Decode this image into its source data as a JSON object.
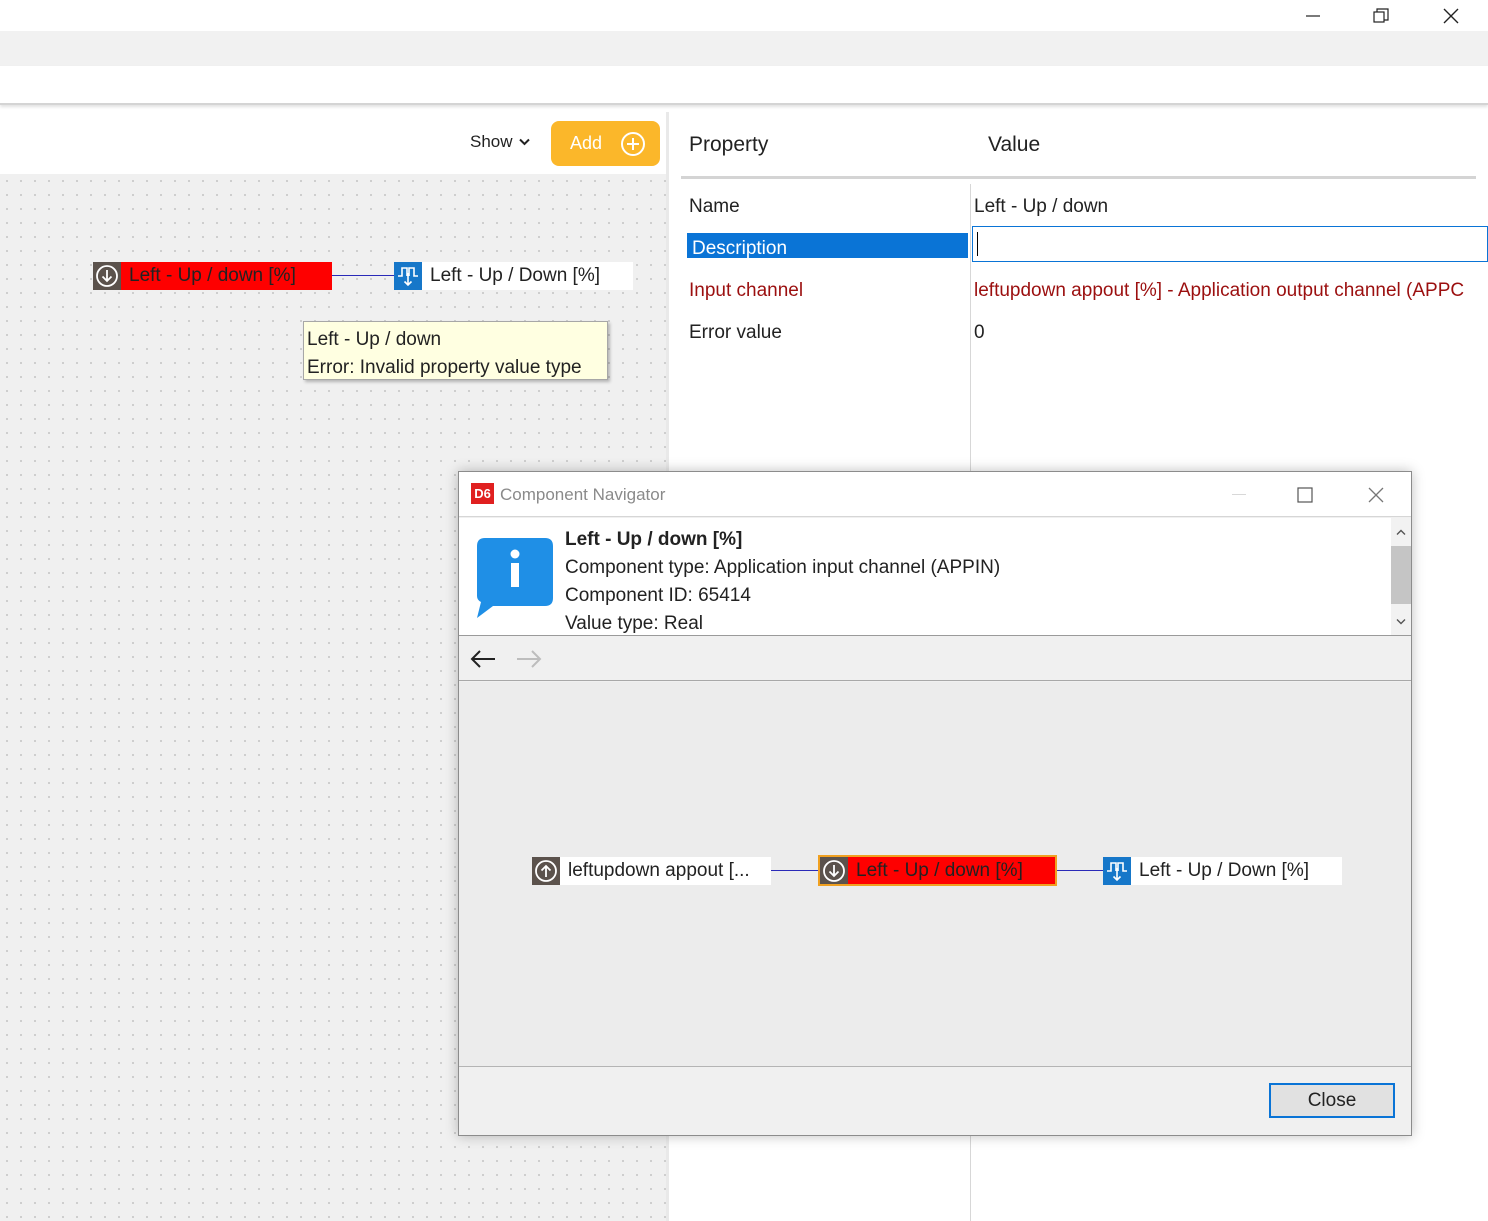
{
  "window": {
    "minimize_icon": "minimize-icon",
    "restore_icon": "restore-icon",
    "close_icon": "close-icon"
  },
  "toolbar": {
    "show_label": "Show",
    "add_label": "Add"
  },
  "canvas": {
    "nodes": [
      {
        "label": "Left - Up / down [%]",
        "icon": "channel-input-icon",
        "status": "error"
      },
      {
        "label": "Left - Up / Down [%]",
        "icon": "channel-output-icon",
        "status": "ok"
      }
    ],
    "tooltip": {
      "title": "Left - Up / down",
      "message": "Error: Invalid property value type"
    }
  },
  "properties": {
    "header_property": "Property",
    "header_value": "Value",
    "rows": [
      {
        "name": "Name",
        "value": "Left - Up / down"
      },
      {
        "name": "Description",
        "value": ""
      },
      {
        "name": "Input channel",
        "value": "leftupdown appout [%] - Application output channel (APPC"
      },
      {
        "name": "Error value",
        "value": "0"
      }
    ]
  },
  "dialog": {
    "logo": "D6",
    "title": "Component Navigator",
    "info": {
      "name": "Left - Up / down [%]",
      "type": "Component type: Application input channel (APPIN)",
      "id": "Component ID: 65414",
      "value_type": "Value type: Real"
    },
    "graph": [
      {
        "label": "leftupdown appout [...",
        "icon": "channel-input-up-icon",
        "status": "ok"
      },
      {
        "label": "Left - Up / down [%]",
        "icon": "channel-input-icon",
        "status": "error-selected"
      },
      {
        "label": "Left - Up / Down [%]",
        "icon": "channel-output-icon",
        "status": "ok"
      }
    ],
    "close_label": "Close"
  },
  "colors": {
    "accent": "#fbb72a",
    "error": "#fe0000",
    "selection": "#0a74d6",
    "error_text": "#9b0f0f"
  }
}
